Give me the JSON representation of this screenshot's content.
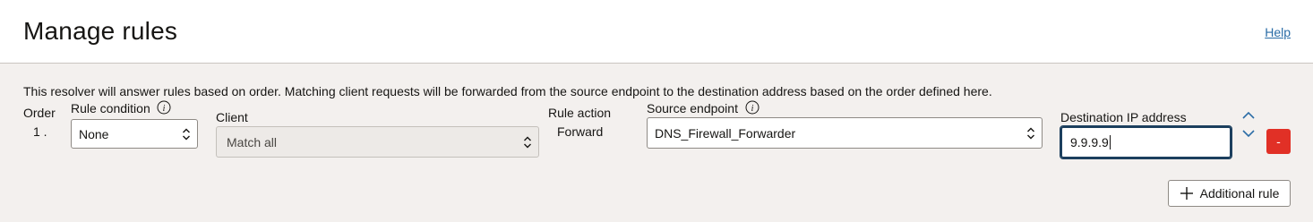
{
  "header": {
    "title": "Manage rules",
    "help_label": "Help"
  },
  "description": "This resolver will answer rules based on order. Matching client requests will be forwarded from the source endpoint to the destination address based on the order defined here.",
  "columns": {
    "order": "Order",
    "rule_condition": "Rule condition",
    "client": "Client",
    "rule_action": "Rule action",
    "source_endpoint": "Source endpoint",
    "destination_ip": "Destination IP address"
  },
  "rules": [
    {
      "order": "1 .",
      "rule_condition": "None",
      "client": "Match all",
      "rule_action": "Forward",
      "source_endpoint": "DNS_Firewall_Forwarder",
      "destination_ip": "9.9.9.9",
      "remove_label": "-"
    }
  ],
  "add_rule_label": "Additional rule",
  "colors": {
    "link": "#2a6ca6",
    "remove": "#e13026",
    "focus": "#1c3f5e",
    "background": "#f3f0ee"
  },
  "icons": [
    "info-icon",
    "chevron-up-down-icon",
    "arrow-up-icon",
    "arrow-down-icon",
    "plus-icon"
  ]
}
